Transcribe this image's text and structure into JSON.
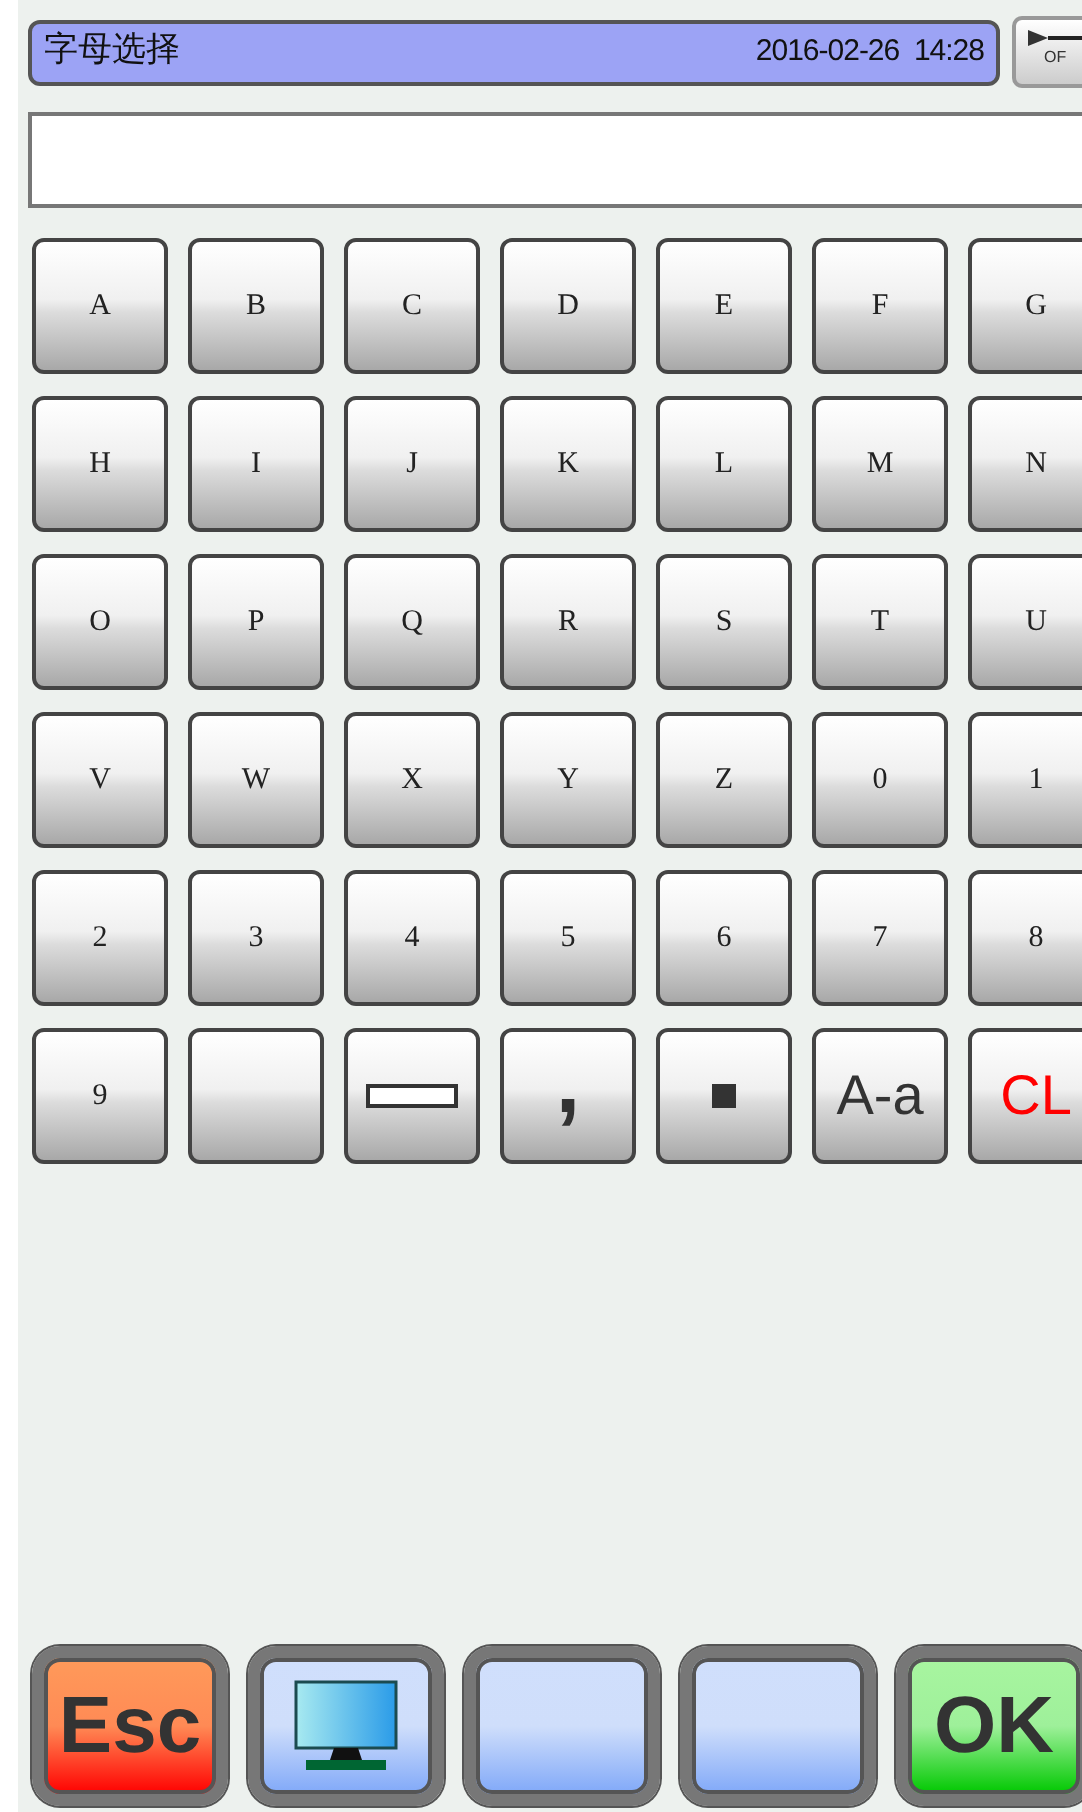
{
  "header": {
    "title": "字母选择",
    "datetime": "2016-02-26  14:28"
  },
  "side_button": {
    "label": "OF"
  },
  "keys": [
    {
      "kind": "char",
      "label": "A"
    },
    {
      "kind": "char",
      "label": "B"
    },
    {
      "kind": "char",
      "label": "C"
    },
    {
      "kind": "char",
      "label": "D"
    },
    {
      "kind": "char",
      "label": "E"
    },
    {
      "kind": "char",
      "label": "F"
    },
    {
      "kind": "char",
      "label": "G"
    },
    {
      "kind": "char",
      "label": "H"
    },
    {
      "kind": "char",
      "label": "I"
    },
    {
      "kind": "char",
      "label": "J"
    },
    {
      "kind": "char",
      "label": "K"
    },
    {
      "kind": "char",
      "label": "L"
    },
    {
      "kind": "char",
      "label": "M"
    },
    {
      "kind": "char",
      "label": "N"
    },
    {
      "kind": "char",
      "label": "O"
    },
    {
      "kind": "char",
      "label": "P"
    },
    {
      "kind": "char",
      "label": "Q"
    },
    {
      "kind": "char",
      "label": "R"
    },
    {
      "kind": "char",
      "label": "S"
    },
    {
      "kind": "char",
      "label": "T"
    },
    {
      "kind": "char",
      "label": "U"
    },
    {
      "kind": "char",
      "label": "V"
    },
    {
      "kind": "char",
      "label": "W"
    },
    {
      "kind": "char",
      "label": "X"
    },
    {
      "kind": "char",
      "label": "Y"
    },
    {
      "kind": "char",
      "label": "Z"
    },
    {
      "kind": "char",
      "label": "0"
    },
    {
      "kind": "char",
      "label": "1"
    },
    {
      "kind": "char",
      "label": "2"
    },
    {
      "kind": "char",
      "label": "3"
    },
    {
      "kind": "char",
      "label": "4"
    },
    {
      "kind": "char",
      "label": "5"
    },
    {
      "kind": "char",
      "label": "6"
    },
    {
      "kind": "char",
      "label": "7"
    },
    {
      "kind": "char",
      "label": "8"
    },
    {
      "kind": "char",
      "label": "9"
    },
    {
      "kind": "blank"
    },
    {
      "kind": "space"
    },
    {
      "kind": "punct",
      "label": ","
    },
    {
      "kind": "dot"
    },
    {
      "kind": "case",
      "label": "A-a"
    },
    {
      "kind": "clear",
      "label": "CL"
    }
  ],
  "actions": [
    {
      "kind": "esc",
      "label": "Esc"
    },
    {
      "kind": "monitor"
    },
    {
      "kind": "blank"
    },
    {
      "kind": "blank"
    },
    {
      "kind": "ok",
      "label": "OK"
    }
  ]
}
